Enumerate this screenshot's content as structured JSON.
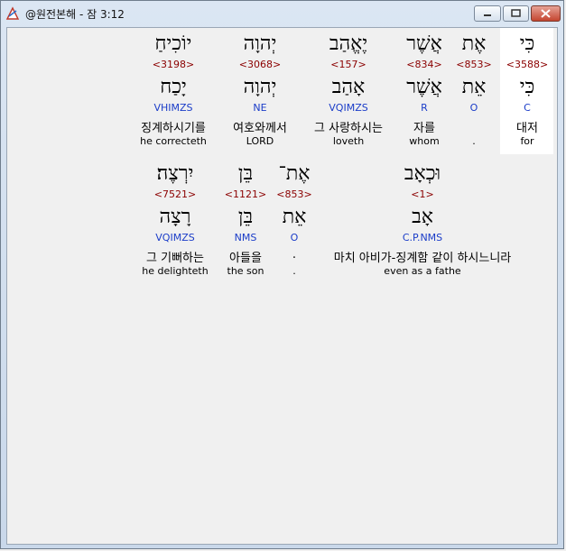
{
  "window": {
    "title": "@원전본해 - 잠 3:12"
  },
  "rows": [
    {
      "words": [
        {
          "surface": "כִּי",
          "strong": "<3588>",
          "lemma": "כִּי",
          "morph": "C",
          "korean": "대저",
          "english": "for"
        },
        {
          "surface": "אֶת",
          "strong": "<853>",
          "lemma": "אֵת",
          "morph": "O",
          "korean": "",
          "english": "."
        },
        {
          "surface": "אֲשֶׁר",
          "strong": "<834>",
          "lemma": "אֲשֶׁר",
          "morph": "R",
          "korean": "자를",
          "english": "whom"
        },
        {
          "surface": "יֶאֱהַב",
          "strong": "<157>",
          "lemma": "אָהַב",
          "morph": "VQIMZS",
          "korean": "그 사랑하시는",
          "english": "loveth"
        },
        {
          "surface": "יְהוָה",
          "strong": "<3068>",
          "lemma": "יְהוָה",
          "morph": "NE",
          "korean": "여호와께서",
          "english": "LORD"
        },
        {
          "surface": "יוֹכִיחַ",
          "strong": "<3198>",
          "lemma": "יָכַח",
          "morph": "VHIMZS",
          "korean": "징계하시기를",
          "english": "he correcteth"
        }
      ]
    },
    {
      "words": [
        {
          "surface": "וּכְאָב",
          "strong": "<1>",
          "lemma": "אָב",
          "morph": "C.P.NMS",
          "korean": "마치 아비가-징계함 같이 하시느니라",
          "english": "even as a fathe"
        },
        {
          "surface": "אֶת־",
          "strong": "<853>",
          "lemma": "אֵת",
          "morph": "O",
          "korean": ".",
          "english": "."
        },
        {
          "surface": "בֵּן",
          "strong": "<1121>",
          "lemma": "בֵּן",
          "morph": "NMS",
          "korean": "아들을",
          "english": "the son"
        },
        {
          "surface": "יִרְצֶה׃",
          "strong": "<7521>",
          "lemma": "רָצָה",
          "morph": "VQIMZS",
          "korean": "그 기뻐하는",
          "english": "he delighteth"
        }
      ]
    }
  ]
}
